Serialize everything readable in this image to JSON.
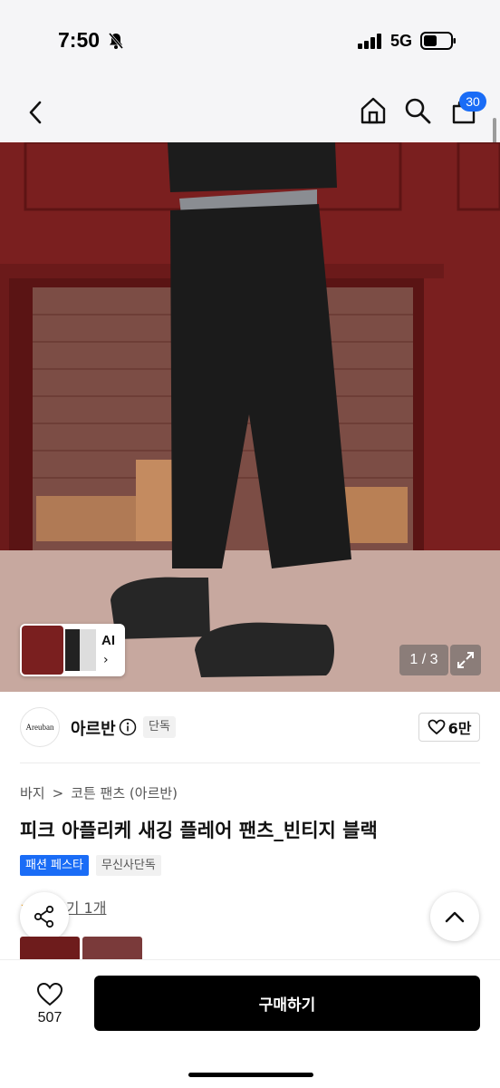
{
  "status_bar": {
    "time": "7:50",
    "network": "5G"
  },
  "nav": {
    "cart_count": "30",
    "icons": [
      "back-icon",
      "home-icon",
      "search-icon",
      "cart-icon"
    ]
  },
  "gallery": {
    "ai_label": "AI",
    "page_counter": "1 / 3"
  },
  "brand": {
    "logo_text": "Areuban",
    "name": "아르반",
    "badge": "단독",
    "likes": "6만"
  },
  "breadcrumb": {
    "category": "바지",
    "separator": ">",
    "subcategory": "코튼 팬츠 (아르반)"
  },
  "product": {
    "title": "피크 아플리케 새깅 플레어 팬츠_빈티지 블랙",
    "badges": [
      "패션 페스타",
      "무신사단독"
    ],
    "review_text": "후기 1개"
  },
  "bottom_bar": {
    "wish_count": "507",
    "buy_label": "구매하기"
  },
  "colors": {
    "accent": "#1a6cf6",
    "buy_button": "#000000",
    "wall": "#7a1f1f"
  }
}
